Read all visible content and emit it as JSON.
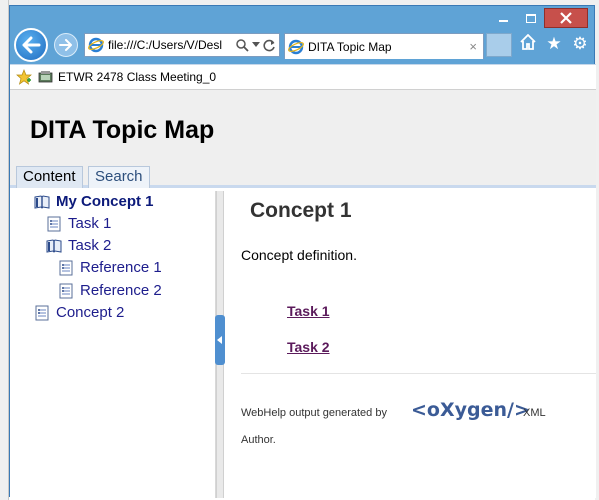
{
  "browser": {
    "address": "file:///C:/Users/V/Desl",
    "tab_title": "DITA Topic Map",
    "tab_close": "×",
    "favorites_item": "ETWR 2478 Class Meeting_0"
  },
  "page": {
    "title": "DITA Topic Map",
    "tabs": [
      {
        "label": "Content"
      },
      {
        "label": "Search"
      }
    ]
  },
  "toc": {
    "items": [
      {
        "label": "My Concept 1",
        "icon": "open-book-icon",
        "selected": true
      },
      {
        "label": "Task 1",
        "icon": "topic-page-icon"
      },
      {
        "label": "Task 2",
        "icon": "open-book-icon"
      },
      {
        "label": "Reference 1",
        "icon": "topic-page-icon"
      },
      {
        "label": "Reference 2",
        "icon": "topic-page-icon"
      },
      {
        "label": "Concept 2",
        "icon": "topic-page-icon"
      }
    ]
  },
  "content": {
    "title": "Concept 1",
    "definition": "Concept definition.",
    "links": [
      "Task 1",
      "Task 2"
    ],
    "footer_prefix": "WebHelp output generated by",
    "logo_text": "<oXygen/>",
    "footer_suffix": "XML",
    "footer_line2": "Author."
  },
  "colors": {
    "window_frame": "#5fa3d6",
    "close_button": "#c7504b",
    "link_visited": "#5b1a5b",
    "toc_link": "#1d1d8c",
    "logo_red": "#e03a1e",
    "logo_blue": "#3b5b96"
  }
}
